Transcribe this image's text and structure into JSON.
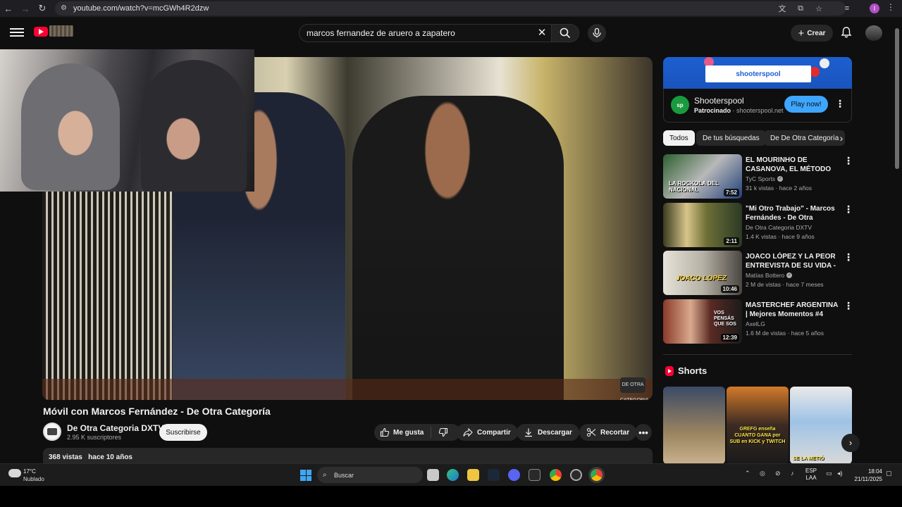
{
  "browser": {
    "url": "youtube.com/watch?v=mcGWh4R2dzw",
    "profile_initial": "I"
  },
  "header": {
    "search_query": "marcos fernandez de aruero a zapatero",
    "create_label": "Crear"
  },
  "video": {
    "title": "Móvil con Marcos Fernández - De Otra Categoría",
    "channel_name": "De Otra Categoria DXTV",
    "subscribers": "2.95 K suscriptores",
    "subscribe_label": "Suscribirse",
    "like_label": "Me gusta",
    "share_label": "Compartir",
    "download_label": "Descargar",
    "clip_label": "Recortar",
    "views": "368 vistas",
    "published": "hace 10 años",
    "watermark": "DE OTRA CATEGORIA"
  },
  "ad": {
    "banner_text": "shooterspool",
    "title": "Shooterspool",
    "sponsored": "Patrocinado",
    "domain": "shooterspool.net",
    "cta": "Play now!",
    "logo_text": "sp"
  },
  "chips": [
    "Todos",
    "De tus búsquedas",
    "De De Otra Categoría"
  ],
  "recommendations": [
    {
      "title": "EL MOURINHO DE CASANOVA, EL MÉTODO ANTI FAIR PLAY ...",
      "channel": "TyC Sports",
      "verified": true,
      "meta": "31 k vistas · hace 2 años",
      "duration": "7:52",
      "thumb_text": "LA ROCKOLA DEL NACIONAL"
    },
    {
      "title": "\"Mi Otro Trabajo\" - Marcos Fernándes - De Otra Categoría",
      "channel": "De Otra Categoria DXTV",
      "verified": false,
      "meta": "1.4 K vistas · hace 9 años",
      "duration": "2:11",
      "thumb_text": ""
    },
    {
      "title": "JOACO LÓPEZ Y LA PEOR ENTREVISTA DE SU VIDA - ...",
      "channel": "Matías Bottero",
      "verified": true,
      "meta": "2 M de vistas · hace 7 meses",
      "duration": "10:46",
      "thumb_text": "JOACO LOPEZ"
    },
    {
      "title": "MASTERCHEF ARGENTINA | Mejores Momentos #4",
      "channel": "AxelLG",
      "verified": false,
      "meta": "1.6 M de vistas · hace 5 años",
      "duration": "12:39",
      "thumb_text": "VOS PENSÁS QUE SOS"
    }
  ],
  "shorts": {
    "title": "Shorts",
    "items": [
      {
        "caption": ""
      },
      {
        "caption": "GREFG enseña CUANTO GANA por SUB en KICK y TWITCH"
      },
      {
        "caption": "SE LA METIÓ"
      }
    ]
  },
  "taskbar": {
    "temperature": "17°C",
    "weather": "Nublado",
    "search_placeholder": "Buscar",
    "lang_top": "ESP",
    "lang_bottom": "LAA",
    "time": "18:04",
    "date": "21/11/2025"
  }
}
